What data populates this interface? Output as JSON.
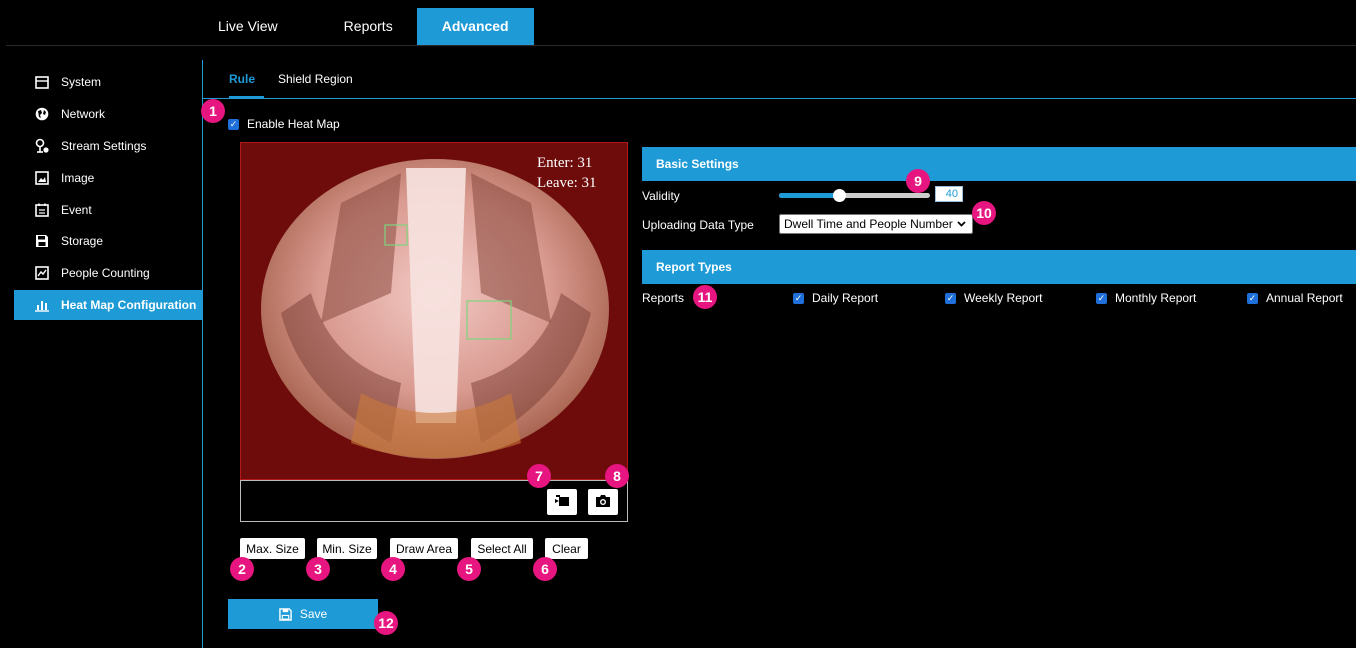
{
  "topnav": {
    "tabs": [
      {
        "label": "Live View"
      },
      {
        "label": "Reports"
      },
      {
        "label": "Advanced"
      }
    ]
  },
  "sidebar": {
    "items": [
      {
        "label": "System",
        "icon": "window-icon"
      },
      {
        "label": "Network",
        "icon": "globe-icon"
      },
      {
        "label": "Stream Settings",
        "icon": "camera-settings-icon"
      },
      {
        "label": "Image",
        "icon": "image-icon"
      },
      {
        "label": "Event",
        "icon": "calendar-icon"
      },
      {
        "label": "Storage",
        "icon": "floppy-icon"
      },
      {
        "label": "People Counting",
        "icon": "people-counter-icon"
      },
      {
        "label": "Heat Map Configuration",
        "icon": "bar-chart-icon"
      }
    ]
  },
  "subtabs": [
    {
      "label": "Rule"
    },
    {
      "label": "Shield Region"
    }
  ],
  "enable_heat_map": {
    "label": "Enable Heat Map",
    "checked": true
  },
  "video": {
    "enter": "Enter: 31",
    "leave": "Leave: 31"
  },
  "area_buttons": {
    "max_size": "Max. Size",
    "min_size": "Min. Size",
    "draw_area": "Draw Area",
    "select_all": "Select All",
    "clear": "Clear"
  },
  "save": {
    "label": "Save"
  },
  "basic_settings": {
    "header": "Basic Settings",
    "validity_label": "Validity",
    "validity_value": "40",
    "validity_level": 0.4,
    "upload_label": "Uploading Data Type",
    "upload_value": "Dwell Time and People Number"
  },
  "report_types": {
    "header": "Report Types",
    "reports_label": "Reports",
    "options": [
      {
        "label": "Daily Report",
        "checked": true
      },
      {
        "label": "Weekly Report",
        "checked": true
      },
      {
        "label": "Monthly Report",
        "checked": true
      },
      {
        "label": "Annual Report",
        "checked": true
      }
    ]
  },
  "badges": [
    "1",
    "2",
    "3",
    "4",
    "5",
    "6",
    "7",
    "8",
    "9",
    "10",
    "11",
    "12"
  ],
  "colors": {
    "accent": "#1e9bd7",
    "badge": "#e6157f",
    "video_overlay": "#6e0c0c"
  }
}
